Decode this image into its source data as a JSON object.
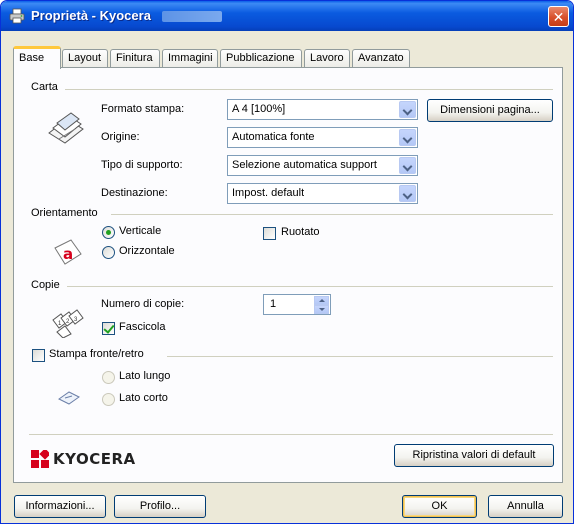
{
  "window": {
    "title": "Proprietà - Kyocera"
  },
  "tabs": [
    "Base",
    "Layout",
    "Finitura",
    "Immagini",
    "Pubblicazione",
    "Lavoro",
    "Avanzato"
  ],
  "carta": {
    "group_label": "Carta",
    "formato_label": "Formato stampa:",
    "formato_value": "A 4  [100%]",
    "dimensioni_button": "Dimensioni pagina...",
    "origine_label": "Origine:",
    "origine_value": "Automatica fonte",
    "supporto_label": "Tipo di supporto:",
    "supporto_value": "Selezione automatica support",
    "destinazione_label": "Destinazione:",
    "destinazione_value": "Impost. default"
  },
  "orientamento": {
    "group_label": "Orientamento",
    "verticale": "Verticale",
    "orizzontale": "Orizzontale",
    "ruotato": "Ruotato",
    "selected": "Verticale",
    "ruotato_checked": false
  },
  "copie": {
    "group_label": "Copie",
    "numero_label": "Numero di copie:",
    "numero_value": "1",
    "fascicola": "Fascicola",
    "fascicola_checked": true
  },
  "fronte_retro": {
    "label": "Stampa fronte/retro",
    "checked": false,
    "lato_lungo": "Lato lungo",
    "lato_corto": "Lato corto"
  },
  "brand": {
    "logo_text": "KYOCERA",
    "logo_color": "#d6001c"
  },
  "buttons": {
    "ripristina": "Ripristina valori di default",
    "informazioni": "Informazioni...",
    "profilo": "Profilo...",
    "ok": "OK",
    "annulla": "Annulla"
  },
  "colors": {
    "titlebar": "#0a5be0",
    "dialog_bg": "#ece9d8",
    "panel_bg": "#fcfcfe",
    "close_button": "#d8502b",
    "check_green": "#21a121"
  }
}
